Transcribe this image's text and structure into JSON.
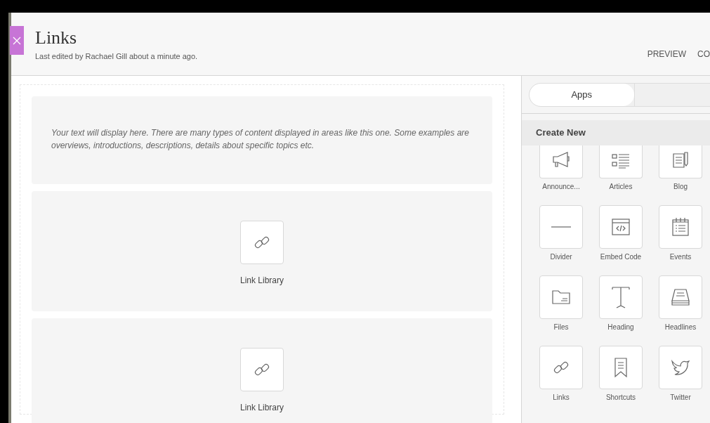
{
  "header": {
    "title": "Links",
    "subtitle": "Last edited by Rachael Gill about a minute ago.",
    "actions": [
      "PREVIEW",
      "CO"
    ]
  },
  "blocks": [
    {
      "kind": "text",
      "text": "Your text will display here. There are many types of content displayed in areas like this one. Some examples are overviews, introductions, descriptions, details about specific topics etc."
    },
    {
      "kind": "app",
      "label": "Link Library"
    },
    {
      "kind": "app",
      "label": "Link Library"
    }
  ],
  "sidebar": {
    "tabs": [
      {
        "label": "Apps",
        "selected": true
      },
      {
        "selected": false
      }
    ],
    "section": "Create New",
    "tiles": [
      {
        "label": "Announce..."
      },
      {
        "label": "Articles"
      },
      {
        "label": "Blog"
      },
      {
        "label": "Divider"
      },
      {
        "label": "Embed Code"
      },
      {
        "label": "Events"
      },
      {
        "label": "Files"
      },
      {
        "label": "Heading"
      },
      {
        "label": "Headlines"
      },
      {
        "label": "Links"
      },
      {
        "label": "Shortcuts"
      },
      {
        "label": "Twitter"
      }
    ]
  }
}
